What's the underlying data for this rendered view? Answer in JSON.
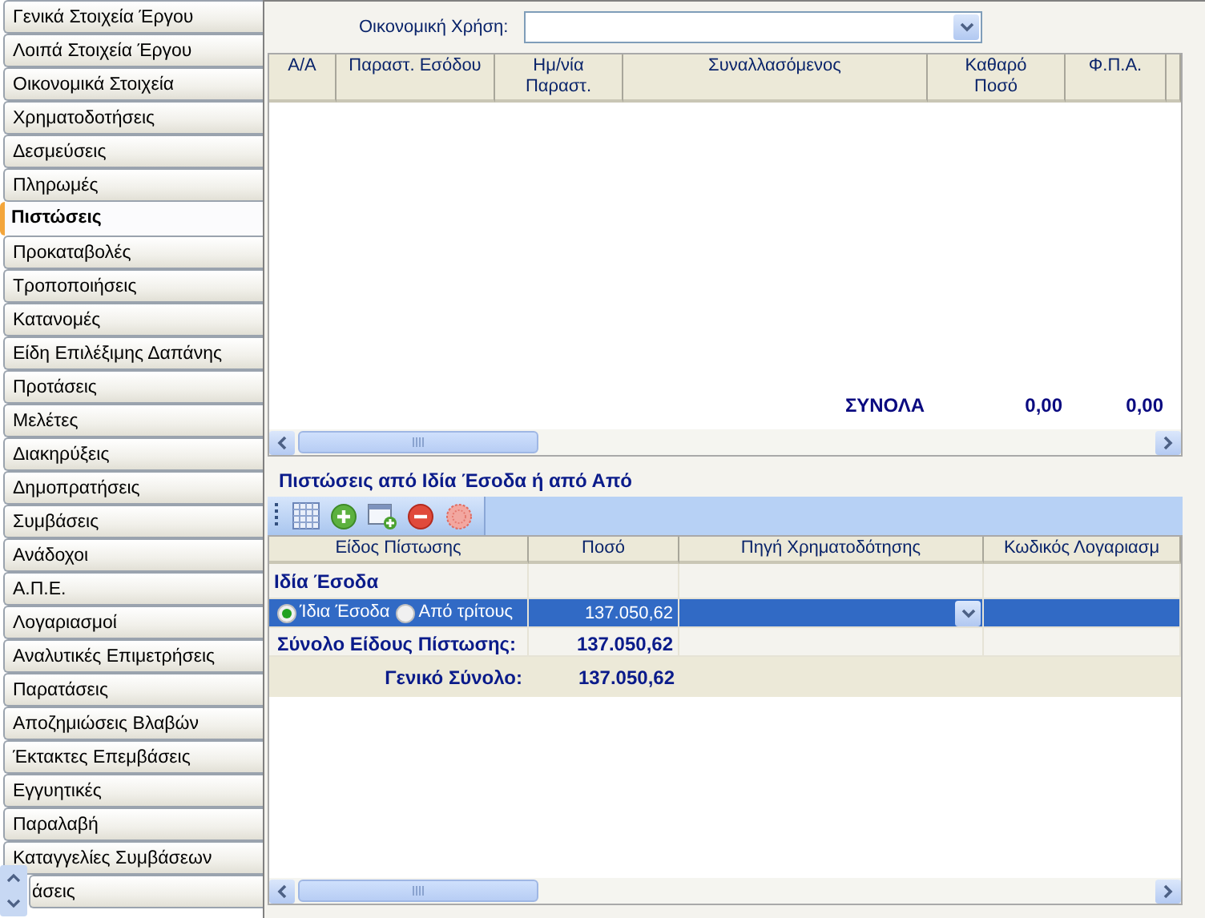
{
  "sidebar": {
    "items": [
      {
        "label": "Γενικά Στοιχεία Έργου",
        "selected": false
      },
      {
        "label": "Λοιπά Στοιχεία Έργου",
        "selected": false
      },
      {
        "label": "Οικονομικά Στοιχεία",
        "selected": false
      },
      {
        "label": "Χρηματοδοτήσεις",
        "selected": false
      },
      {
        "label": "Δεσμεύσεις",
        "selected": false
      },
      {
        "label": "Πληρωμές",
        "selected": false
      },
      {
        "label": "Πιστώσεις",
        "selected": true
      },
      {
        "label": "Προκαταβολές",
        "selected": false
      },
      {
        "label": "Τροποποιήσεις",
        "selected": false
      },
      {
        "label": "Κατανομές",
        "selected": false
      },
      {
        "label": "Είδη Επιλέξιμης Δαπάνης",
        "selected": false
      },
      {
        "label": "Προτάσεις",
        "selected": false
      },
      {
        "label": "Μελέτες",
        "selected": false
      },
      {
        "label": "Διακηρύξεις",
        "selected": false
      },
      {
        "label": "Δημοπρατήσεις",
        "selected": false
      },
      {
        "label": "Συμβάσεις",
        "selected": false
      },
      {
        "label": "Ανάδοχοι",
        "selected": false
      },
      {
        "label": "Α.Π.Ε.",
        "selected": false
      },
      {
        "label": "Λογαριασμοί",
        "selected": false
      },
      {
        "label": "Αναλυτικές Επιμετρήσεις",
        "selected": false
      },
      {
        "label": "Παρατάσεις",
        "selected": false
      },
      {
        "label": "Αποζημιώσεις Βλαβών",
        "selected": false
      },
      {
        "label": "Έκτακτες Επεμβάσεις",
        "selected": false
      },
      {
        "label": "Εγγυητικές",
        "selected": false
      },
      {
        "label": "Παραλαβή",
        "selected": false
      },
      {
        "label": "Καταγγελίες Συμβάσεων",
        "selected": false
      },
      {
        "label": "άσεις",
        "selected": false
      }
    ]
  },
  "fiscal_year": {
    "label": "Οικονομική Χρήση:"
  },
  "receipts_grid": {
    "columns": [
      "Α/Α",
      "Παραστ. Εσόδου",
      "Ημ/νία\nΠαραστ.",
      "Συναλλασόμενος",
      "Καθαρό\nΠοσό",
      "Φ.Π.Α."
    ],
    "totals": {
      "label": "ΣΥΝΟΛΑ",
      "values": [
        "0,00",
        "0,00"
      ]
    }
  },
  "credits": {
    "title": "Πιστώσεις από Ιδία Έσοδα ή από Από",
    "toolbar": [
      {
        "kind": "grid"
      },
      {
        "kind": "add"
      },
      {
        "kind": "new"
      },
      {
        "kind": "remove"
      },
      {
        "kind": "disabled"
      }
    ],
    "columns": [
      "Είδος Πίστωσης",
      "Ποσό",
      "Πηγή Χρηματοδότησης",
      "Κωδικός Λογαριασμ"
    ],
    "group": "Ιδία Έσοδα",
    "rows": [
      {
        "selected": true,
        "options": [
          {
            "label": "Ίδια Έσοδα",
            "selected": true
          },
          {
            "label": "Από τρίτους",
            "selected": false
          }
        ],
        "amount": "137.050,62"
      }
    ],
    "subtotal": {
      "label": "Σύνολο Είδους Πίστωσης:",
      "amount": "137.050,62"
    },
    "total": {
      "label": "Γενικό Σύνολο:",
      "amount": "137.050,62"
    }
  }
}
